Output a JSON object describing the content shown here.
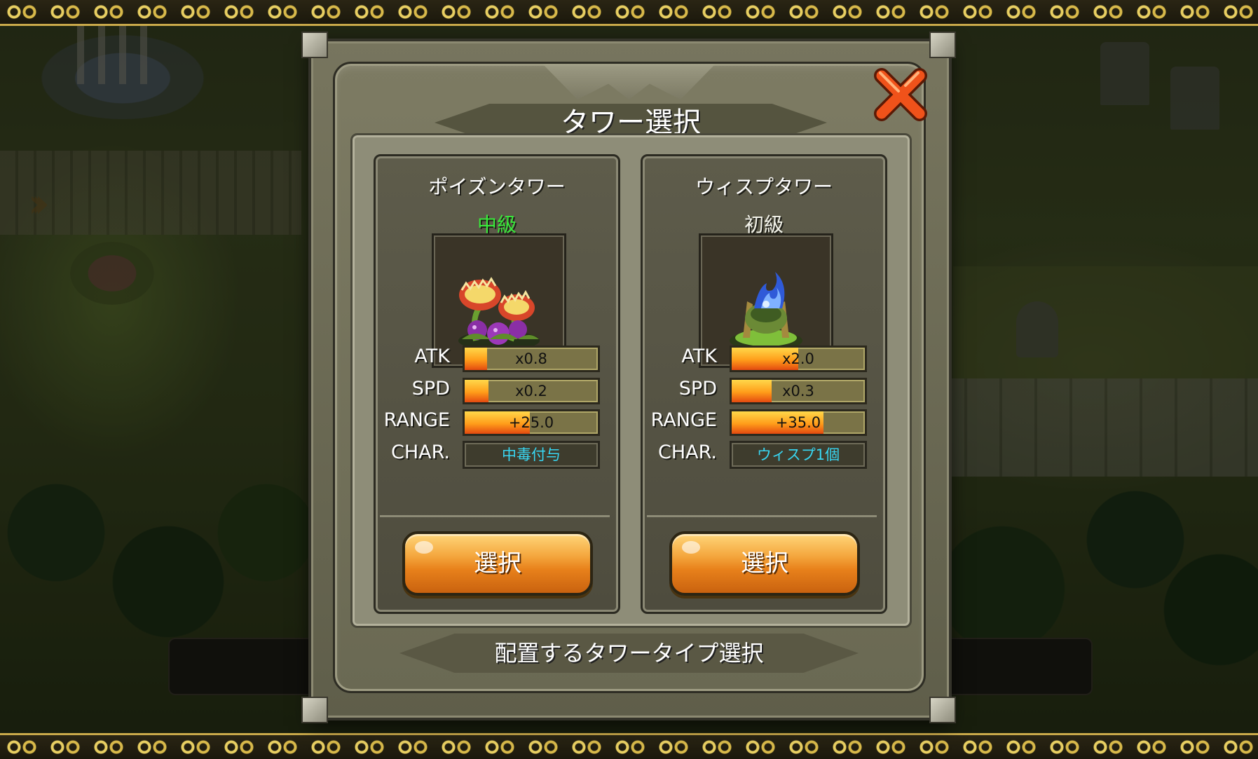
{
  "dialog": {
    "title": "タワー選択",
    "footer": "配置するタワータイプ選択",
    "close_icon": "close-x-icon"
  },
  "colors": {
    "rank_intermediate": "#39e83a",
    "rank_beginner": "#f3f3ea",
    "characteristic_text": "#38d6f2",
    "button_orange": "#e8811b"
  },
  "towers": [
    {
      "name": "ポイズンタワー",
      "rank": "中級",
      "portrait_icon": "venus-flytrap-tower-icon",
      "stats": {
        "atk_label": "ATK",
        "atk_text": "x0.8",
        "atk_level": 0.17,
        "spd_label": "SPD",
        "spd_text": "x0.2",
        "spd_level": 0.18,
        "range_label": "RANGE",
        "range_text": "+25.0",
        "range_level": 0.49,
        "char_label": "CHAR.",
        "char_text": "中毒付与"
      },
      "select_label": "選択"
    },
    {
      "name": "ウィスプタワー",
      "rank": "初級",
      "portrait_icon": "wisp-tower-icon",
      "stats": {
        "atk_label": "ATK",
        "atk_text": "x2.0",
        "atk_level": 0.5,
        "spd_label": "SPD",
        "spd_text": "x0.3",
        "spd_level": 0.3,
        "range_label": "RANGE",
        "range_text": "+35.0",
        "range_level": 0.69,
        "char_label": "CHAR.",
        "char_text": "ウィスプ1個"
      },
      "select_label": "選択"
    }
  ]
}
